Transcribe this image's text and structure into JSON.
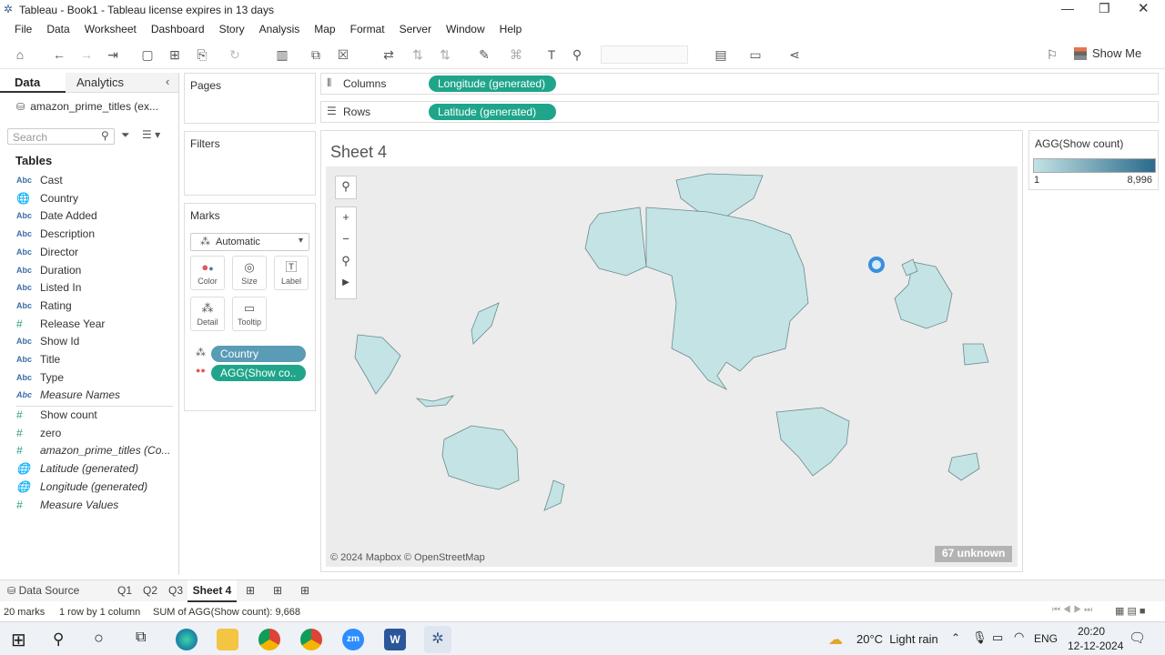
{
  "window": {
    "title": "Tableau - Book1 - Tableau license expires in 13 days",
    "controls": [
      "minimize",
      "restore",
      "close"
    ]
  },
  "menu": [
    "File",
    "Data",
    "Worksheet",
    "Dashboard",
    "Story",
    "Analysis",
    "Map",
    "Format",
    "Server",
    "Window",
    "Help"
  ],
  "toolbar": {
    "show_me": "Show Me"
  },
  "data_pane": {
    "tabs": {
      "data": "Data",
      "analytics": "Analytics"
    },
    "datasource": "amazon_prime_titles (ex...",
    "search_placeholder": "Search",
    "tables_header": "Tables",
    "fields": [
      {
        "icon": "Abc",
        "name": "Cast"
      },
      {
        "icon": "globe",
        "name": "Country"
      },
      {
        "icon": "Abc",
        "name": "Date Added"
      },
      {
        "icon": "Abc",
        "name": "Description"
      },
      {
        "icon": "Abc",
        "name": "Director"
      },
      {
        "icon": "Abc",
        "name": "Duration"
      },
      {
        "icon": "Abc",
        "name": "Listed In"
      },
      {
        "icon": "Abc",
        "name": "Rating"
      },
      {
        "icon": "#",
        "name": "Release Year"
      },
      {
        "icon": "Abc",
        "name": "Show Id"
      },
      {
        "icon": "Abc",
        "name": "Title"
      },
      {
        "icon": "Abc",
        "name": "Type"
      },
      {
        "icon": "Abc",
        "name": "Measure Names"
      }
    ],
    "measures": [
      {
        "icon": "=#",
        "name": "Show count"
      },
      {
        "icon": "=#",
        "name": "zero"
      },
      {
        "icon": "#",
        "name": "amazon_prime_titles (Co..."
      },
      {
        "icon": "globe",
        "name": "Latitude (generated)"
      },
      {
        "icon": "globe",
        "name": "Longitude (generated)"
      },
      {
        "icon": "#",
        "name": "Measure Values"
      }
    ]
  },
  "cards": {
    "pages": "Pages",
    "filters": "Filters",
    "marks": "Marks",
    "mark_type": "Automatic",
    "mark_buttons": {
      "color": "Color",
      "size": "Size",
      "label": "Label",
      "detail": "Detail",
      "tooltip": "Tooltip"
    },
    "mark_pills": {
      "country": "Country",
      "agg": "AGG(Show co.."
    }
  },
  "shelves": {
    "columns_label": "Columns",
    "rows_label": "Rows",
    "columns_pill": "Longitude (generated)",
    "rows_pill": "Latitude (generated)"
  },
  "view": {
    "sheet_title": "Sheet 4",
    "attribution": "© 2024 Mapbox © OpenStreetMap",
    "unknown_badge": "67 unknown"
  },
  "legend": {
    "title": "AGG(Show count)",
    "min": "1",
    "max": "8,996",
    "color_low": "#c3e3e4",
    "color_high": "#2a6a8c"
  },
  "sheet_tabs": {
    "data_source": "Data Source",
    "tabs": [
      "Q1",
      "Q2",
      "Q3",
      "Sheet 4"
    ],
    "active": "Sheet 4"
  },
  "status": {
    "marks": "20 marks",
    "rows_cols": "1 row by 1 column",
    "sum": "SUM of AGG(Show count): 9,668"
  },
  "taskbar": {
    "weather": "20°C  Light rain",
    "lang": "ENG",
    "time": "20:20",
    "date": "12-12-2024"
  }
}
